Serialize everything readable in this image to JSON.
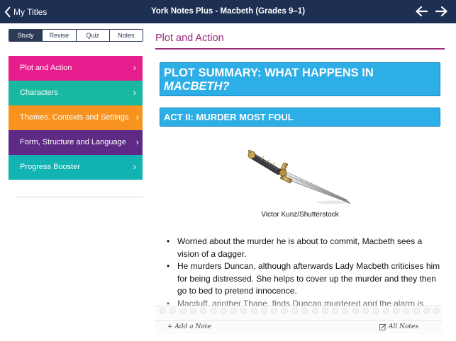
{
  "header": {
    "back_label": "My Titles",
    "title": "York Notes Plus - Macbeth (Grades 9–1)"
  },
  "tabs": [
    {
      "label": "Study",
      "active": true
    },
    {
      "label": "Revise",
      "active": false
    },
    {
      "label": "Quiz",
      "active": false
    },
    {
      "label": "Notes",
      "active": false
    }
  ],
  "menu": [
    {
      "label": "Plot and Action",
      "color": "#e61d8c"
    },
    {
      "label": "Characters",
      "color": "#19b8a1"
    },
    {
      "label": "Themes, Contexts and Settings",
      "color": "#f7931e"
    },
    {
      "label": "Form, Structure and Language",
      "color": "#5e2a86"
    },
    {
      "label": "Progress Booster",
      "color": "#11b3b3"
    }
  ],
  "content": {
    "page_title": "Plot and Action",
    "summary_line1": "PLOT SUMMARY: WHAT HAPPENS IN",
    "summary_line2": "MACBETH?",
    "act_heading": "ACT II: MURDER MOST FOUL",
    "image_caption": "Victor Kunz/Shutterstock",
    "bullets": [
      "Worried about the murder he is about to commit, Macbeth sees a vision of a dagger.",
      "He murders Duncan, although afterwards Lady Macbeth criticises him for being distressed. She helps to cover up the murder and they then go to bed to pretend innocence.",
      "Macduff, another Thane, finds Duncan murdered and the alarm is sounded."
    ]
  },
  "notes": {
    "add_note": "+ Add a Note",
    "all_notes": "All Notes"
  },
  "colors": {
    "header_bg": "#1d2f52",
    "accent_magenta": "#9c2a7c",
    "heading_box": "#2eaee6"
  },
  "icons": [
    "chevron-left-icon",
    "arrow-left-icon",
    "arrow-right-icon",
    "chevron-right-icon",
    "edit-note-icon"
  ]
}
